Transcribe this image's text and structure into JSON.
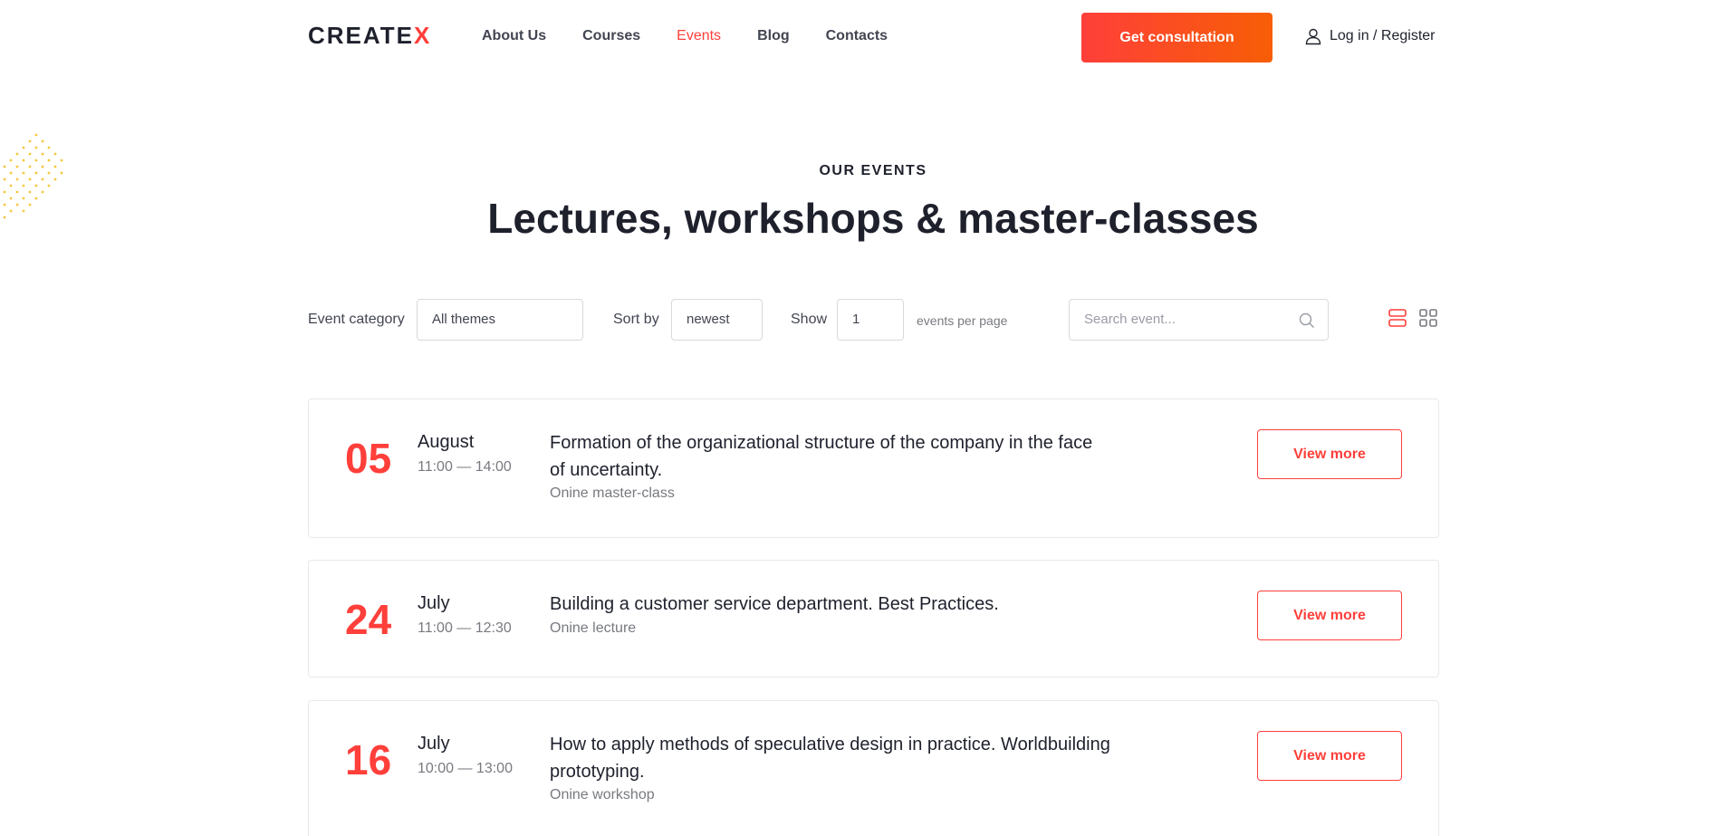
{
  "header": {
    "logo_main": "CREATE",
    "logo_accent": "X",
    "nav": [
      {
        "label": "About Us",
        "active": false
      },
      {
        "label": "Courses",
        "active": false
      },
      {
        "label": "Events",
        "active": true
      },
      {
        "label": "Blog",
        "active": false
      },
      {
        "label": "Contacts",
        "active": false
      }
    ],
    "cta_label": "Get consultation",
    "login_label": "Log in / Register",
    "login_icon": "user-icon"
  },
  "section": {
    "eyebrow": "OUR EVENTS",
    "title": "Lectures, workshops & master-classes"
  },
  "filters": {
    "category_label": "Event category",
    "category_value": "All themes",
    "sort_label": "Sort by",
    "sort_value": "newest",
    "show_label": "Show",
    "show_value": "1",
    "per_page_label": "events per page",
    "search_placeholder": "Search event...",
    "search_icon": "search-icon",
    "view_list_icon": "list-view-icon",
    "view_grid_icon": "grid-view-icon"
  },
  "events": [
    {
      "day": "05",
      "month": "August",
      "time": "11:00 — 14:00",
      "title_line1": "Formation of the organizational structure of the company in the face",
      "title_line2": "of uncertainty.",
      "type": "Onine master-class",
      "button": "View more"
    },
    {
      "day": "24",
      "month": "July",
      "time": "11:00 — 12:30",
      "title_line1": "Building a customer service department. Best Practices.",
      "title_line2": "",
      "type": "Onine lecture",
      "button": "View more"
    },
    {
      "day": "16",
      "month": "July",
      "time": "10:00 — 13:00",
      "title_line1": "How to apply methods of speculative design in practice. Worldbuilding",
      "title_line2": "prototyping.",
      "type": "Onine workshop",
      "button": "View more"
    }
  ],
  "colors": {
    "accent": "#ff3f3a",
    "accent_gradient_end": "#f75e05",
    "text_dark": "#1e212c",
    "text_muted": "#787a80",
    "border": "#e5e8ed",
    "dots": "#f5c73d"
  }
}
